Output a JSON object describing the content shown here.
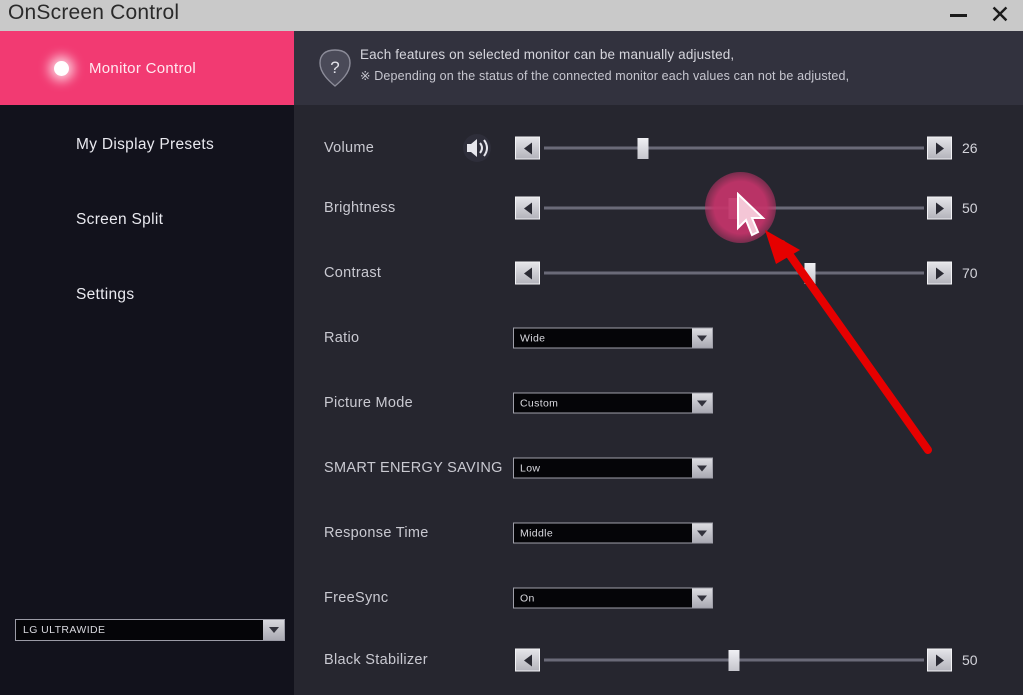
{
  "window": {
    "title": "OnScreen Control",
    "minimize_label": "–",
    "close_label": "✕"
  },
  "sidebar": {
    "active_item": {
      "label": "Monitor Control",
      "icon": "radio-dot-icon",
      "accent": "#f23a72"
    },
    "items": [
      {
        "label": "My Display Presets"
      },
      {
        "label": "Screen Split"
      },
      {
        "label": "Settings"
      }
    ],
    "monitor_selector": {
      "value": "LG ULTRAWIDE",
      "icon": "chevron-down-icon"
    }
  },
  "banner": {
    "icon": "help-question-icon",
    "line1": "Each features on selected monitor can be manually adjusted,",
    "line2": "※ Depending on the status of the connected monitor each values can not be adjusted,"
  },
  "controls": {
    "sliders": [
      {
        "label": "Volume",
        "value": "26",
        "percent": 26,
        "icon": "speaker-icon",
        "left_icon": "triangle-left-icon",
        "right_icon": "triangle-right-icon"
      },
      {
        "label": "Brightness",
        "value": "50",
        "percent": 50,
        "left_icon": "triangle-left-icon",
        "right_icon": "triangle-right-icon"
      },
      {
        "label": "Contrast",
        "value": "70",
        "percent": 70,
        "left_icon": "triangle-left-icon",
        "right_icon": "triangle-right-icon"
      },
      {
        "label": "Black Stabilizer",
        "value": "50",
        "percent": 50,
        "left_icon": "triangle-left-icon",
        "right_icon": "triangle-right-icon"
      }
    ],
    "dropdowns": [
      {
        "label": "Ratio",
        "value": "Wide",
        "icon": "chevron-down-icon"
      },
      {
        "label": "Picture Mode",
        "value": "Custom",
        "icon": "chevron-down-icon"
      },
      {
        "label": "SMART ENERGY SAVING",
        "value": "Low",
        "icon": "chevron-down-icon"
      },
      {
        "label": "Response Time",
        "value": "Middle",
        "icon": "chevron-down-icon"
      },
      {
        "label": "FreeSync",
        "value": "On",
        "icon": "chevron-down-icon"
      }
    ]
  },
  "annotations": {
    "click_highlight_color": "#c4346a",
    "arrow_color": "#e60000",
    "cursor": "mouse-pointer"
  }
}
